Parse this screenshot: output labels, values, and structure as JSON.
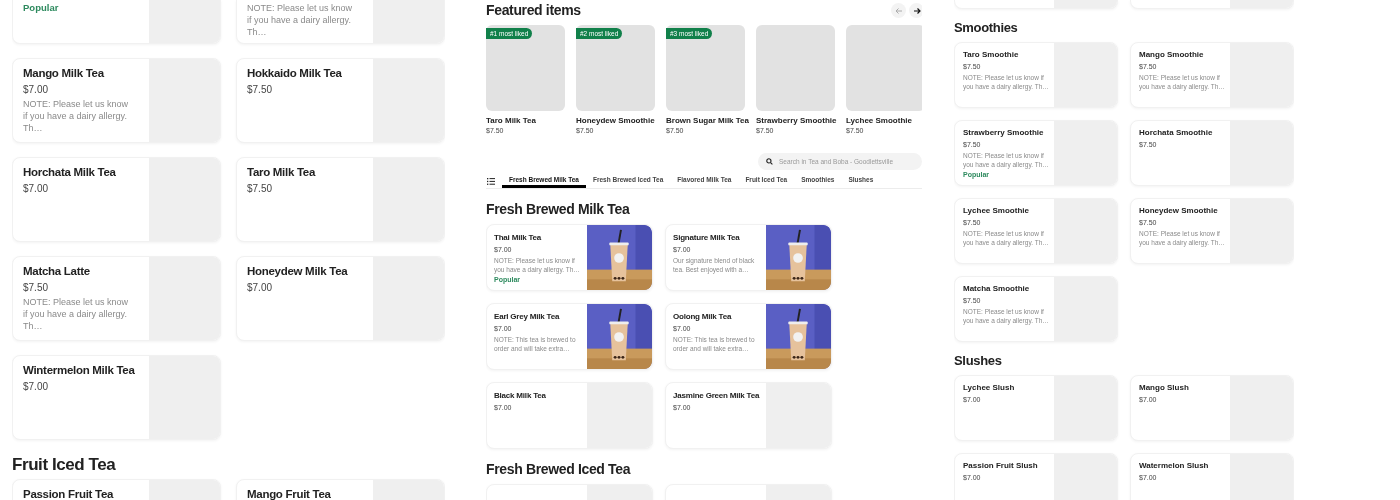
{
  "panels": [
    {
      "sections": [
        {
          "clipped_top": true,
          "items": [
            {
              "kind": "plain",
              "badge": "Popular"
            },
            {
              "kind": "plain",
              "note": "NOTE: Please let us know if you have a dairy allergy. Th…"
            }
          ]
        },
        {
          "items": [
            {
              "kind": "plain",
              "name": "Mango Milk Tea",
              "price": "$7.00",
              "note": "NOTE: Please let us know if you have a dairy allergy. Th…"
            },
            {
              "kind": "plain",
              "name": "Hokkaido Milk Tea",
              "price": "$7.50"
            },
            {
              "kind": "plain",
              "name": "Horchata Milk Tea",
              "price": "$7.00"
            },
            {
              "kind": "plain",
              "name": "Taro Milk Tea",
              "price": "$7.50"
            },
            {
              "kind": "plain",
              "name": "Matcha Latte",
              "price": "$7.50",
              "note": "NOTE: Please let us know if you have a dairy allergy. Th…"
            },
            {
              "kind": "plain",
              "name": "Honeydew Milk Tea",
              "price": "$7.00"
            },
            {
              "kind": "plain",
              "name": "Wintermelon Milk Tea",
              "price": "$7.00"
            }
          ]
        },
        {
          "title": "Fruit Iced Tea",
          "items": [
            {
              "kind": "plain",
              "name": "Passion Fruit Tea"
            },
            {
              "kind": "plain",
              "name": "Mango Fruit Tea"
            }
          ]
        }
      ]
    },
    {
      "featured": {
        "title": "Featured items",
        "items": [
          {
            "name": "Taro Milk Tea",
            "price": "$7.50",
            "badge": "#1 most liked"
          },
          {
            "name": "Honeydew Smoothie",
            "price": "$7.50",
            "badge": "#2 most liked"
          },
          {
            "name": "Brown Sugar Milk Tea",
            "price": "$7.50",
            "badge": "#3 most liked"
          },
          {
            "name": "Strawberry Smoothie",
            "price": "$7.50"
          },
          {
            "name": "Lychee Smoothie",
            "price": "$7.50"
          }
        ]
      },
      "search": {
        "placeholder": "Search in Tea and Boba - Goodlettsville"
      },
      "tabs": [
        {
          "label": "Fresh Brewed Milk Tea",
          "selected": true
        },
        {
          "label": "Fresh Brewed Iced Tea",
          "selected": false
        },
        {
          "label": "Flavored Milk Tea",
          "selected": false
        },
        {
          "label": "Fruit Iced Tea",
          "selected": false
        },
        {
          "label": "Smoothies",
          "selected": false
        },
        {
          "label": "Slushes",
          "selected": false
        }
      ],
      "sections": [
        {
          "title": "Fresh Brewed Milk Tea",
          "items": [
            {
              "name": "Thai Milk Tea",
              "price": "$7.00",
              "note": "NOTE: Please let us know if you have a dairy allergy. Th…",
              "badge": "Popular"
            },
            {
              "name": "Signature Milk Tea",
              "price": "$7.00",
              "note": "Our signature blend of black tea. Best enjoyed with a…"
            },
            {
              "name": "Earl Grey Milk Tea",
              "price": "$7.00",
              "note": "NOTE: This tea is brewed to order and will take extra…"
            },
            {
              "name": "Oolong Milk Tea",
              "price": "$7.00",
              "note": "NOTE: This tea is brewed to order and will take extra…"
            },
            {
              "kind": "plain",
              "name": "Black Milk Tea",
              "price": "$7.00"
            },
            {
              "kind": "plain",
              "name": "Jasmine Green Milk Tea",
              "price": "$7.00"
            }
          ]
        },
        {
          "title": "Fresh Brewed Iced Tea",
          "items": [
            {
              "kind": "cut"
            },
            {
              "kind": "cut"
            }
          ]
        }
      ]
    },
    {
      "sections": [
        {
          "clipped_top": true,
          "items": [
            {
              "kind": "cut"
            },
            {
              "kind": "cut"
            }
          ]
        },
        {
          "title": "Smoothies",
          "items": [
            {
              "kind": "plain",
              "name": "Taro Smoothie",
              "price": "$7.50",
              "note": "NOTE: Please let us know if you have a dairy allergy. Th…"
            },
            {
              "kind": "plain",
              "name": "Mango Smoothie",
              "price": "$7.50",
              "note": "NOTE: Please let us know if you have a dairy allergy. Th…"
            },
            {
              "kind": "plain",
              "name": "Strawberry Smoothie",
              "price": "$7.50",
              "note": "NOTE: Please let us know if you have a dairy allergy. Th…",
              "badge": "Popular"
            },
            {
              "kind": "plain",
              "name": "Horchata Smoothie",
              "price": "$7.50"
            },
            {
              "kind": "plain",
              "name": "Lychee Smoothie",
              "price": "$7.50",
              "note": "NOTE: Please let us know if you have a dairy allergy. Th…"
            },
            {
              "kind": "plain",
              "name": "Honeydew Smoothie",
              "price": "$7.50",
              "note": "NOTE: Please let us know if you have a dairy allergy. Th…"
            },
            {
              "kind": "plain",
              "name": "Matcha Smoothie",
              "price": "$7.50",
              "note": "NOTE: Please let us know if you have a dairy allergy. Th…"
            }
          ]
        },
        {
          "title": "Slushes",
          "items": [
            {
              "kind": "plain",
              "name": "Lychee Slush",
              "price": "$7.00"
            },
            {
              "kind": "plain",
              "name": "Mango Slush",
              "price": "$7.00"
            },
            {
              "kind": "plain",
              "name": "Passion Fruit Slush",
              "price": "$7.00"
            },
            {
              "kind": "plain",
              "name": "Watermelon Slush",
              "price": "$7.00"
            }
          ]
        }
      ]
    }
  ]
}
